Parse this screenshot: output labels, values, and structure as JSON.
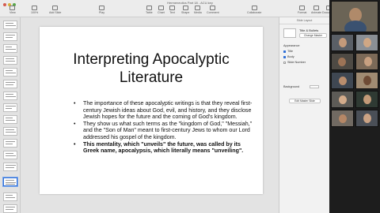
{
  "window": {
    "title": "Hermeneutics Part 18 - ACU.key"
  },
  "toolbar": {
    "left": [
      {
        "name": "view",
        "label": "View"
      },
      {
        "name": "zoom",
        "label": "100%"
      },
      {
        "name": "add-slide",
        "label": "Add Slide"
      }
    ],
    "play": "Play",
    "center": [
      "Table",
      "Chart",
      "Text",
      "Shape",
      "Media",
      "Comment"
    ],
    "collaborate": "Collaborate",
    "right": [
      "Format",
      "Animate",
      "Document"
    ]
  },
  "slide": {
    "title_line1": "Interpreting Apocalyptic",
    "title_line2": "Literature",
    "bullets": [
      "The importance of these apocalyptic writings is that they reveal first-century Jewish ideas about God, evil, and history, and they disclose Jewish hopes for the future and the coming of God's kingdom.",
      "They show us what such terms as the \"kingdom of God,\" \"Messiah,\" and the \"Son of Man\" meant to first-century Jews to whom our Lord addressed his gospel of the kingdom.",
      "This mentality, which \"unveils\" the future, was called by its Greek name, apocalypsis, which literally means \"unveiling\"."
    ]
  },
  "inspector": {
    "header": "Slide Layout",
    "layout_name": "Title & Bullets",
    "change_master": "Change Master",
    "appearance": "Appearance",
    "options": [
      {
        "label": "Title",
        "checked": true
      },
      {
        "label": "Body",
        "checked": true
      },
      {
        "label": "Slide Number",
        "checked": false
      }
    ],
    "background": "Background",
    "edit_master": "Edit Master Slide"
  },
  "colors": {
    "accent": "#2f6fd6",
    "slide_bg": "#ffffff"
  }
}
